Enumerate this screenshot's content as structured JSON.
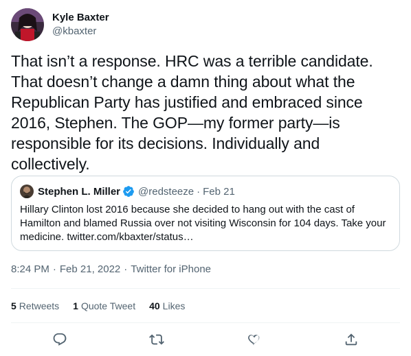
{
  "author": {
    "display_name": "Kyle Baxter",
    "handle": "@kbaxter",
    "avatar_icon": "avatar-icon"
  },
  "tweet": {
    "text": "That isn’t a response. HRC was a terrible candidate. That doesn’t change a damn thing about what the Republican Party has justified and embraced since 2016, Stephen. The GOP—my former party—is responsible for its decisions. Individually and collectively."
  },
  "quote": {
    "display_name": "Stephen L. Miller",
    "handle": "@redsteeze",
    "dot": "·",
    "date": "Feb 21",
    "verified_icon": "verified-icon",
    "text": "Hillary Clinton lost 2016 because she decided to hang out with the cast of Hamilton and blamed Russia over not visiting Wisconsin for 104 days. Take your medicine. twitter.com/kbaxter/status…"
  },
  "meta": {
    "time": "8:24 PM",
    "sep1": "·",
    "date": "Feb 21, 2022",
    "sep2": "·",
    "source": "Twitter for iPhone"
  },
  "stats": {
    "retweets_count": "5",
    "retweets_label": "Retweets",
    "quotes_count": "1",
    "quotes_label": "Quote Tweet",
    "likes_count": "40",
    "likes_label": "Likes"
  },
  "actions": {
    "icons": [
      "reply-icon",
      "retweet-icon",
      "like-icon",
      "share-icon"
    ]
  },
  "colors": {
    "text": "#0f1419",
    "secondary": "#536471",
    "border": "#cfd9de",
    "verified": "#1d9bf0"
  }
}
